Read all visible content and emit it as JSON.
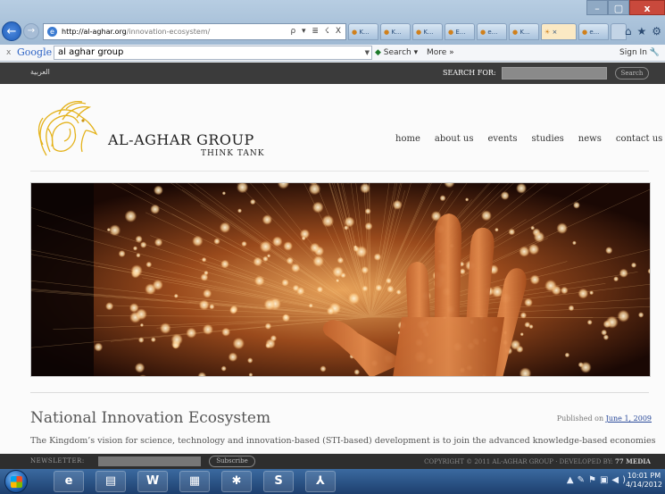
{
  "browser": {
    "window_controls": {
      "minimize": "–",
      "maximize": "▢",
      "close": "x"
    },
    "url": {
      "domain": "http://al-aghar.org",
      "path": "/innovation-ecosystem/"
    },
    "address_controls": "ρ ▾ ≣ ☇ X",
    "tabs": [
      {
        "label": "K..."
      },
      {
        "label": "K..."
      },
      {
        "label": "K..."
      },
      {
        "label": "E..."
      },
      {
        "label": "e..."
      },
      {
        "label": "K..."
      },
      {
        "label": "×"
      },
      {
        "label": "e..."
      }
    ],
    "toolbar": {
      "close": "x",
      "google_logo": "Google",
      "search_value": "al aghar group",
      "search_button": "Search ▾",
      "more": "More »",
      "sign_in": "Sign In"
    }
  },
  "site": {
    "top_bar": {
      "arabic_link": "العربية",
      "search_label": "SEARCH FOR:",
      "search_button": "Search"
    },
    "brand": {
      "name": "AL-AGHAR GROUP",
      "subtitle": "THINK TANK"
    },
    "nav": [
      "home",
      "about us",
      "events",
      "studies",
      "news",
      "contact us"
    ],
    "article": {
      "title": "National Innovation Ecosystem",
      "published_prefix": "Published on",
      "published_date": "June 1, 2009",
      "intro": "The Kingdom’s vision for science, technology and innovation-based (STI-based) development is to join the advanced knowledge-based economies"
    },
    "footer": {
      "newsletter_label": "NEWSLETTER:",
      "subscribe_button": "Subscribe",
      "copyright": "COPYRIGHT © 2011 AL-AGHAR GROUP  ·  DEVELOPED BY:",
      "developer": "77 MEDIA"
    }
  },
  "taskbar": {
    "apps": [
      {
        "icon": "internet-explorer-icon",
        "glyph": "e"
      },
      {
        "icon": "folder-icon",
        "glyph": "▤"
      },
      {
        "icon": "word-icon",
        "glyph": "W"
      },
      {
        "icon": "calculator-icon",
        "glyph": "▦"
      },
      {
        "icon": "network-icon",
        "glyph": "✱"
      },
      {
        "icon": "skype-icon",
        "glyph": "S"
      },
      {
        "icon": "pdf-icon",
        "glyph": "⅄"
      }
    ],
    "clock": {
      "time": "10:01 PM",
      "date": "4/14/2012"
    }
  }
}
